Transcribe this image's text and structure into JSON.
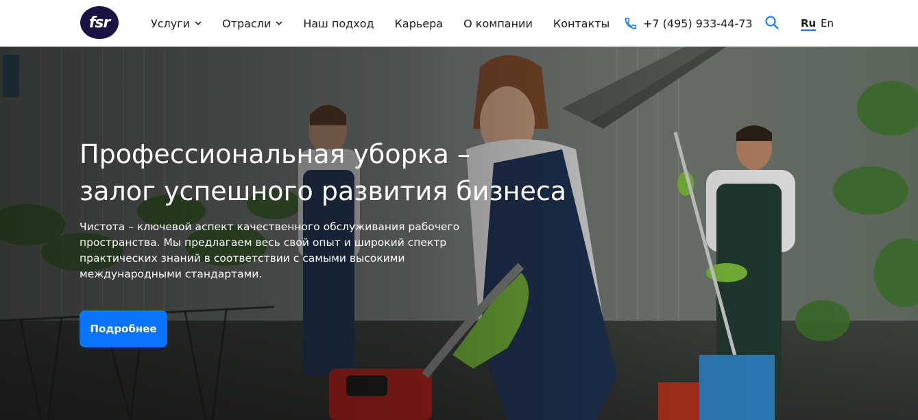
{
  "header": {
    "logo_text": "fsr",
    "nav": [
      {
        "label": "Услуги",
        "has_dropdown": true
      },
      {
        "label": "Отрасли",
        "has_dropdown": true
      },
      {
        "label": "Наш подход",
        "has_dropdown": false
      },
      {
        "label": "Карьера",
        "has_dropdown": false
      },
      {
        "label": "О компании",
        "has_dropdown": false
      },
      {
        "label": "Контакты",
        "has_dropdown": false
      }
    ],
    "phone": "+7 (495) 933-44-73",
    "icons": {
      "phone": "phone-icon",
      "search": "search-icon",
      "chevron": "chevron-down-icon"
    },
    "languages": [
      {
        "code": "Ru",
        "active": true
      },
      {
        "code": "En",
        "active": false
      }
    ]
  },
  "hero": {
    "title_line1": "Профессиональная уборка –",
    "title_line2": "залог успешного развития бизнеса",
    "description": "Чистота – ключевой аспект качественного обслуживания рабочего пространства. Мы предлагаем весь свой опыт и широкий спектр практических знаний в соответствии с самыми высокими международными стандартами.",
    "button_label": "Подробнее"
  },
  "colors": {
    "accent": "#0a74ff",
    "logo_bg": "#1a1346",
    "text_dark": "#1b1b1b"
  }
}
